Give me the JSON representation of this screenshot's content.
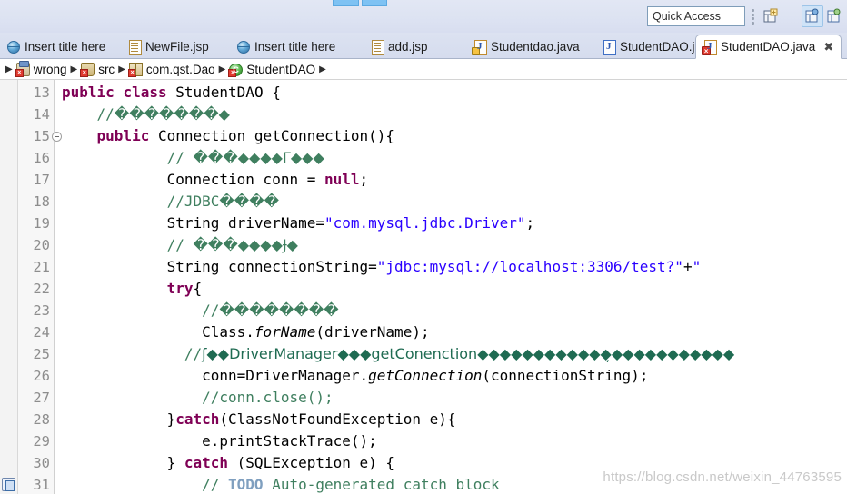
{
  "toolbar": {
    "quick_access_placeholder": "Quick Access",
    "perspective_buttons": [
      {
        "name": "open-perspective-icon",
        "label": ""
      },
      {
        "name": "java-perspective-icon",
        "label": ""
      },
      {
        "name": "java-ee-perspective-icon",
        "label": ""
      }
    ]
  },
  "tabs": [
    {
      "label": "Insert title here",
      "icon": "globe-icon",
      "type": "globe",
      "badge": "none",
      "active": false,
      "closable": false
    },
    {
      "label": "NewFile.jsp",
      "icon": "jsp-file-icon",
      "type": "doc",
      "badge": "none",
      "active": false,
      "closable": false
    },
    {
      "label": "Insert title here",
      "icon": "globe-icon",
      "type": "globe",
      "badge": "none",
      "active": false,
      "closable": false
    },
    {
      "label": "add.jsp",
      "icon": "jsp-file-icon",
      "type": "doc",
      "badge": "none",
      "active": false,
      "closable": false
    },
    {
      "label": "Studentdao.java",
      "icon": "java-file-icon",
      "type": "java",
      "badge": "warning",
      "active": false,
      "closable": false
    },
    {
      "label": "StudentDAO.java",
      "icon": "java-file-icon",
      "type": "javaplain",
      "badge": "none",
      "active": false,
      "closable": false
    },
    {
      "label": "StudentDAO.java",
      "icon": "java-file-error-icon",
      "type": "java",
      "badge": "error",
      "active": true,
      "closable": true,
      "close_glyph": "✖"
    }
  ],
  "breadcrumb": {
    "separator": "▶",
    "items": [
      {
        "label": "wrong",
        "icon": "project-icon",
        "icon_kind": "proj",
        "badge": "error"
      },
      {
        "label": "src",
        "icon": "source-folder-icon",
        "icon_kind": "src",
        "badge": "error"
      },
      {
        "label": "com.qst.Dao",
        "icon": "package-icon",
        "icon_kind": "pkg",
        "badge": "error"
      },
      {
        "label": "StudentDAO",
        "icon": "class-icon",
        "icon_kind": "cls",
        "badge": "error"
      }
    ]
  },
  "editor": {
    "watermark": "https://blog.csdn.net/weixin_44763595",
    "first_line": 13,
    "fold_line": 15,
    "todo_marker_line": 31,
    "lines": [
      {
        "n": 13,
        "tokens": [
          {
            "t": "kw",
            "v": "public"
          },
          {
            "t": "pl",
            "v": " "
          },
          {
            "t": "kw",
            "v": "class"
          },
          {
            "t": "pl",
            "v": " StudentDAO {"
          }
        ]
      },
      {
        "n": 14,
        "tokens": [
          {
            "t": "cm",
            "v": "    //"
          },
          {
            "t": "mj",
            "v": "�������\u0001◆"
          }
        ]
      },
      {
        "n": 15,
        "tokens": [
          {
            "t": "kw",
            "v": "    public"
          },
          {
            "t": "pl",
            "v": " Connection getConnection(){"
          }
        ]
      },
      {
        "n": 16,
        "tokens": [
          {
            "t": "cm",
            "v": "            // "
          },
          {
            "t": "mj",
            "v": "���\u0001◆◆◆◆Γ◆◆◆"
          }
        ]
      },
      {
        "n": 17,
        "tokens": [
          {
            "t": "pl",
            "v": "            Connection conn = "
          },
          {
            "t": "kw",
            "v": "null"
          },
          {
            "t": "pl",
            "v": ";"
          }
        ]
      },
      {
        "n": 18,
        "tokens": [
          {
            "t": "cm",
            "v": "            //JDBC"
          },
          {
            "t": "mj",
            "v": "����"
          }
        ]
      },
      {
        "n": 19,
        "tokens": [
          {
            "t": "pl",
            "v": "            String driverName="
          },
          {
            "t": "str",
            "v": "\"com.mysql.jdbc.Driver\""
          },
          {
            "t": "pl",
            "v": ";"
          }
        ]
      },
      {
        "n": 20,
        "tokens": [
          {
            "t": "cm",
            "v": "            // "
          },
          {
            "t": "mj",
            "v": "���\u0001◆◆◆◆Ɉ◆"
          }
        ]
      },
      {
        "n": 21,
        "tokens": [
          {
            "t": "pl",
            "v": "            String connectionString="
          },
          {
            "t": "str",
            "v": "\"jdbc:mysql://localhost:3306/test?\""
          },
          {
            "t": "pl",
            "v": "+"
          },
          {
            "t": "str",
            "v": "\""
          }
        ]
      },
      {
        "n": 22,
        "tokens": [
          {
            "t": "kw",
            "v": "            try"
          },
          {
            "t": "pl",
            "v": "{"
          }
        ]
      },
      {
        "n": 23,
        "tokens": [
          {
            "t": "cm",
            "v": "                //"
          },
          {
            "t": "mj",
            "v": "��������"
          }
        ]
      },
      {
        "n": 24,
        "tokens": [
          {
            "t": "pl",
            "v": "                Class."
          },
          {
            "t": "mth",
            "v": "forName"
          },
          {
            "t": "pl",
            "v": "(driverName);"
          }
        ]
      },
      {
        "n": 25,
        "tokens": [
          {
            "t": "cm",
            "v": "              //"
          },
          {
            "t": "mjd",
            "v": "ʃ◆◆DriverManager◆◆◆getConenction◆◆◆◆\u0001◆◆◆◆◆◆◆◆̦◆◆◆◆◆◆◆◆◆◆◆"
          }
        ]
      },
      {
        "n": 26,
        "tokens": [
          {
            "t": "pl",
            "v": "                conn=DriverManager."
          },
          {
            "t": "mth",
            "v": "getConnection"
          },
          {
            "t": "pl",
            "v": "(connectionString);"
          }
        ]
      },
      {
        "n": 27,
        "tokens": [
          {
            "t": "cm",
            "v": "                //conn.close();"
          }
        ]
      },
      {
        "n": 28,
        "tokens": [
          {
            "t": "pl",
            "v": "            }"
          },
          {
            "t": "kw",
            "v": "catch"
          },
          {
            "t": "pl",
            "v": "(ClassNotFoundException e){"
          }
        ]
      },
      {
        "n": 29,
        "tokens": [
          {
            "t": "pl",
            "v": "                e.printStackTrace();"
          }
        ]
      },
      {
        "n": 30,
        "tokens": [
          {
            "t": "pl",
            "v": "            } "
          },
          {
            "t": "kw",
            "v": "catch"
          },
          {
            "t": "pl",
            "v": " (SQLException e) {"
          }
        ]
      },
      {
        "n": 31,
        "tokens": [
          {
            "t": "cm",
            "v": "                // "
          },
          {
            "t": "tdo",
            "v": "TODO"
          },
          {
            "t": "cm",
            "v": " Auto-generated catch block"
          }
        ]
      }
    ]
  }
}
